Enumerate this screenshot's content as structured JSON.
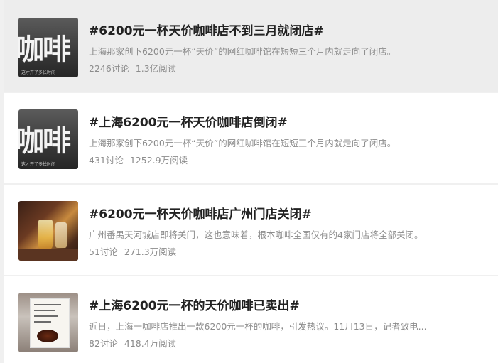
{
  "topics": [
    {
      "title": "#6200元一杯天价咖啡店不到三月就闭店#",
      "description": "上海那家创下6200元一杯“天价”的网红咖啡馆在短短三个月内就走向了闭店。",
      "discussions": "2246讨论",
      "reads": "1.3亿阅读",
      "thumbnail": {
        "type": "coffee-sign",
        "big_text": "咖啡",
        "caption": "这才开了多长时间"
      },
      "highlighted": true
    },
    {
      "title": "#上海6200元一杯天价咖啡店倒闭#",
      "description": "上海那家创下6200元一杯“天价”的网红咖啡馆在短短三个月内就走向了闭店。",
      "discussions": "431讨论",
      "reads": "1252.9万阅读",
      "thumbnail": {
        "type": "coffee-sign",
        "big_text": "咖啡",
        "caption": "这才开了多长时间"
      },
      "highlighted": false
    },
    {
      "title": "#6200元一杯天价咖啡店广州门店关闭#",
      "description": "广州番禺天河城店即将关门，这也意味着，根本咖啡全国仅有的4家门店将全部关闭。",
      "discussions": "51讨论",
      "reads": "271.3万阅读",
      "thumbnail": {
        "type": "cafe-drinks"
      },
      "highlighted": false
    },
    {
      "title": "#上海6200元一杯的天价咖啡已卖出#",
      "description": "近日，上海一咖啡店推出一款6200元一杯的咖啡，引发热议。11月13日，记者致电...",
      "discussions": "82讨论",
      "reads": "418.4万阅读",
      "thumbnail": {
        "type": "menu-cup"
      },
      "highlighted": false
    }
  ]
}
